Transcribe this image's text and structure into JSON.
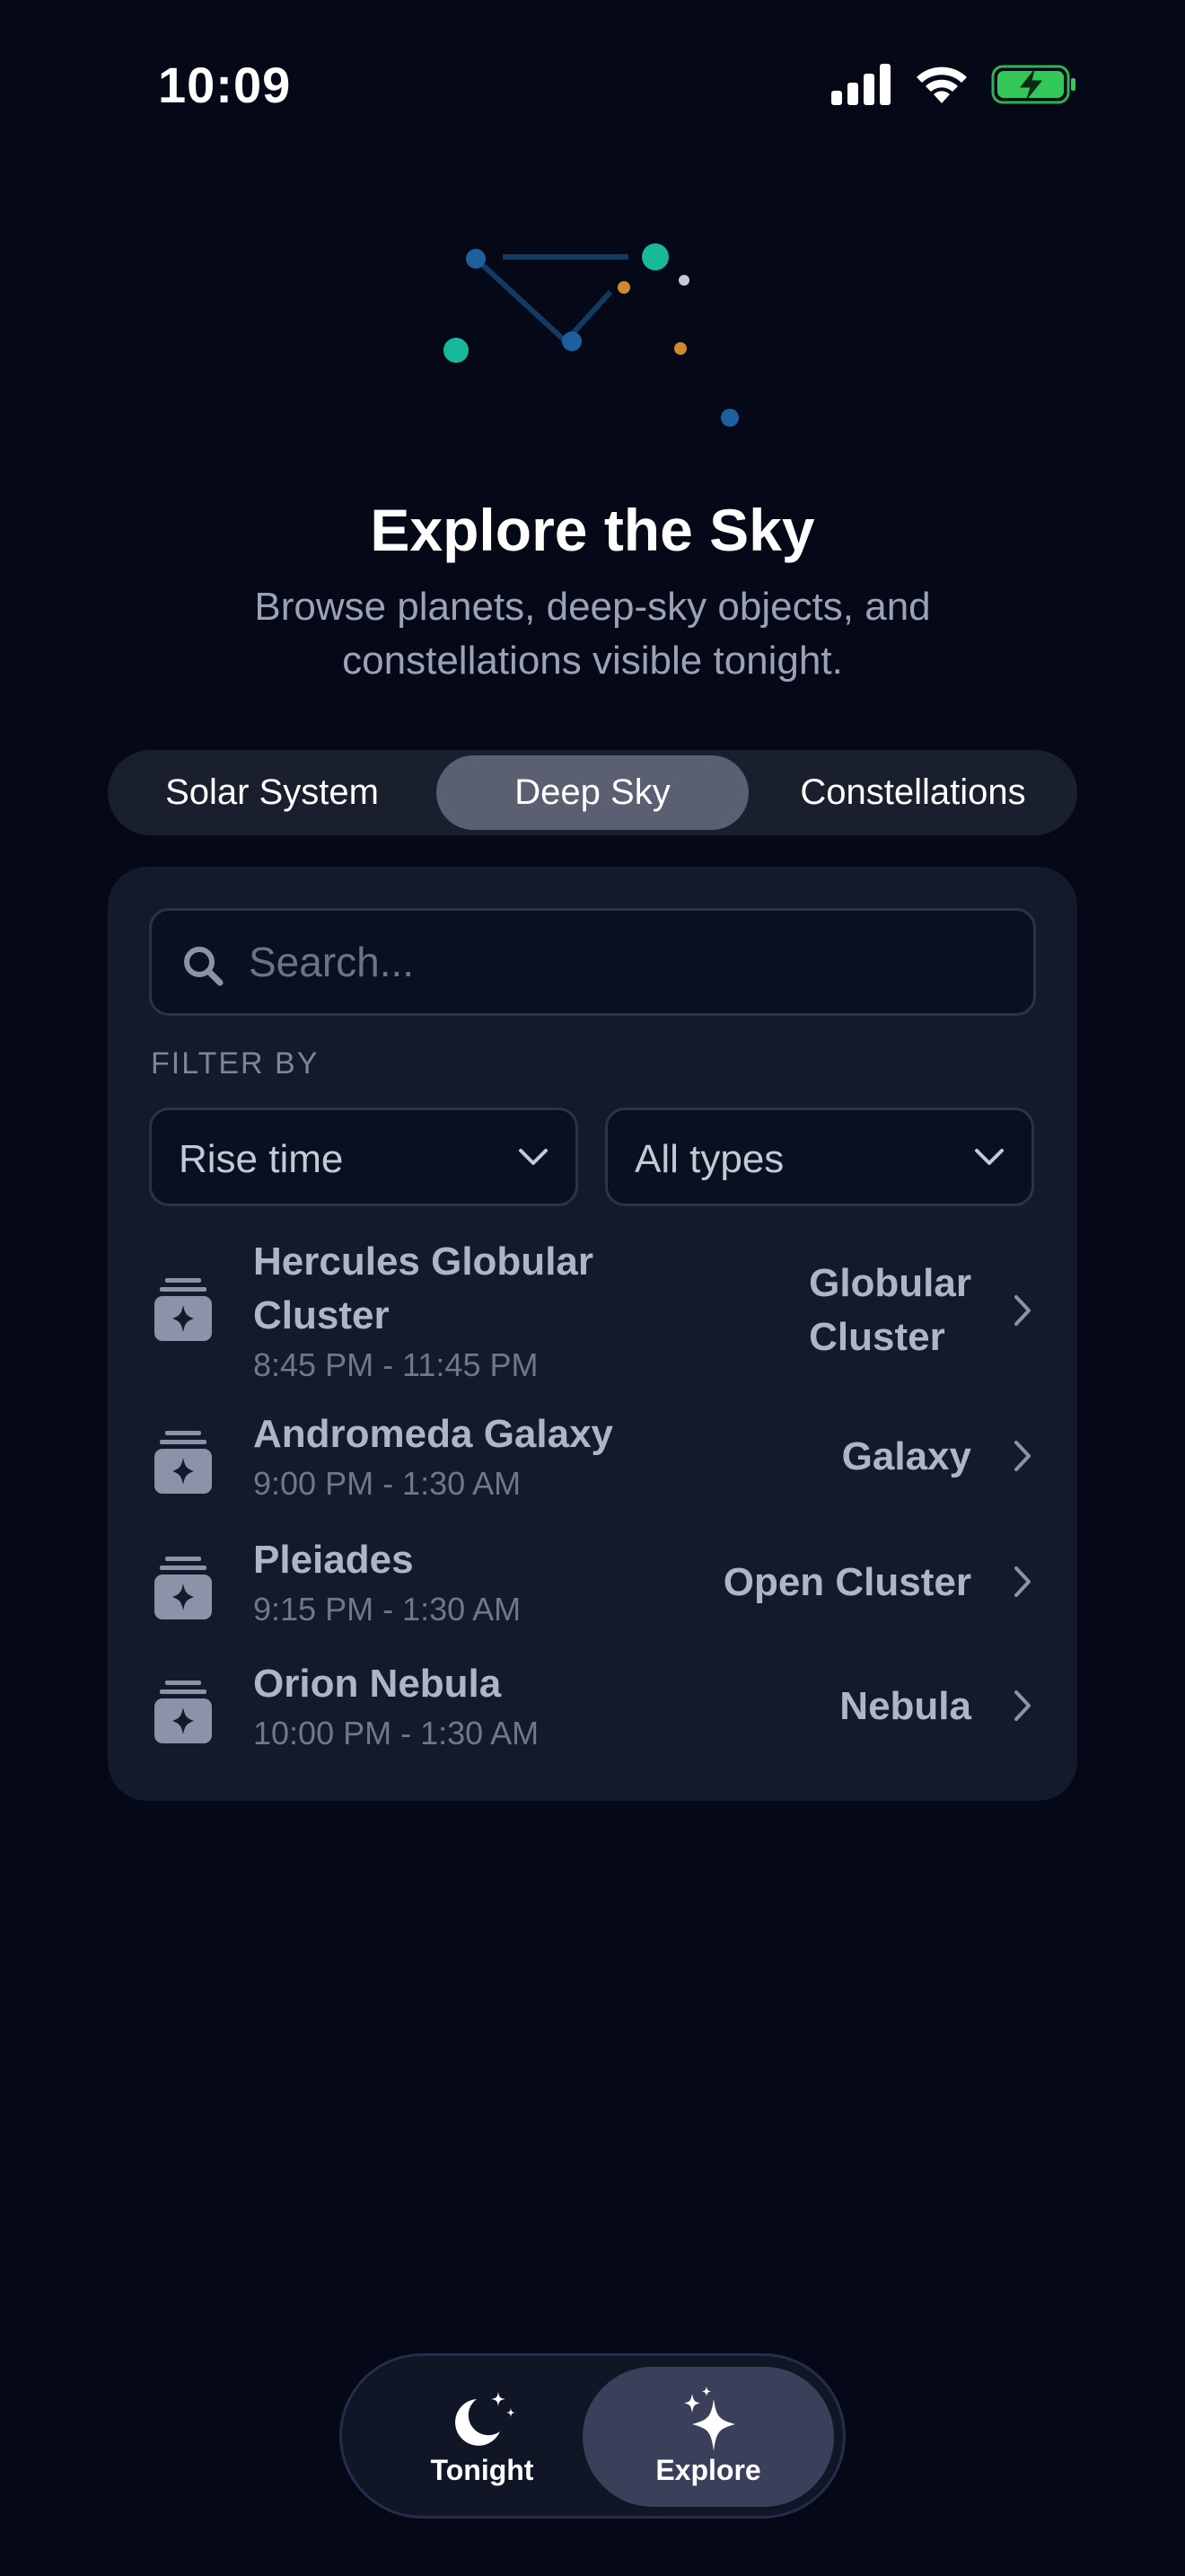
{
  "status": {
    "time": "10:09"
  },
  "header": {
    "title": "Explore the Sky",
    "subtitle": "Browse planets, deep-sky objects, and constellations visible tonight."
  },
  "segments": [
    {
      "label": "Solar System",
      "selected": false
    },
    {
      "label": "Deep Sky",
      "selected": true
    },
    {
      "label": "Constellations",
      "selected": false
    }
  ],
  "search": {
    "placeholder": "Search...",
    "value": ""
  },
  "filters": {
    "label": "FILTER BY",
    "sort": "Rise time",
    "type": "All types"
  },
  "objects": [
    {
      "name": "Hercules Globular Cluster",
      "name_line1": "Hercules Globular",
      "name_line2": "Cluster",
      "time": "8:45 PM - 11:45 PM",
      "type": "Globular Cluster",
      "type_line1": "Globular",
      "type_line2": "Cluster"
    },
    {
      "name": "Andromeda Galaxy",
      "time": "9:00 PM - 1:30 AM",
      "type": "Galaxy"
    },
    {
      "name": "Pleiades",
      "time": "9:15 PM - 1:30 AM",
      "type": "Open Cluster"
    },
    {
      "name": "Orion Nebula",
      "time": "10:00 PM - 1:30 AM",
      "type": "Nebula"
    }
  ],
  "tabs": [
    {
      "label": "Tonight",
      "icon": "moon-stars-icon",
      "selected": false
    },
    {
      "label": "Explore",
      "icon": "sparkles-icon",
      "selected": true
    }
  ],
  "colors": {
    "background": "#050816",
    "card": "#121a2b",
    "accent_teal": "#18b89a",
    "accent_blue": "#1e5f9e",
    "accent_orange": "#d08a2e",
    "battery_green": "#34c759"
  }
}
